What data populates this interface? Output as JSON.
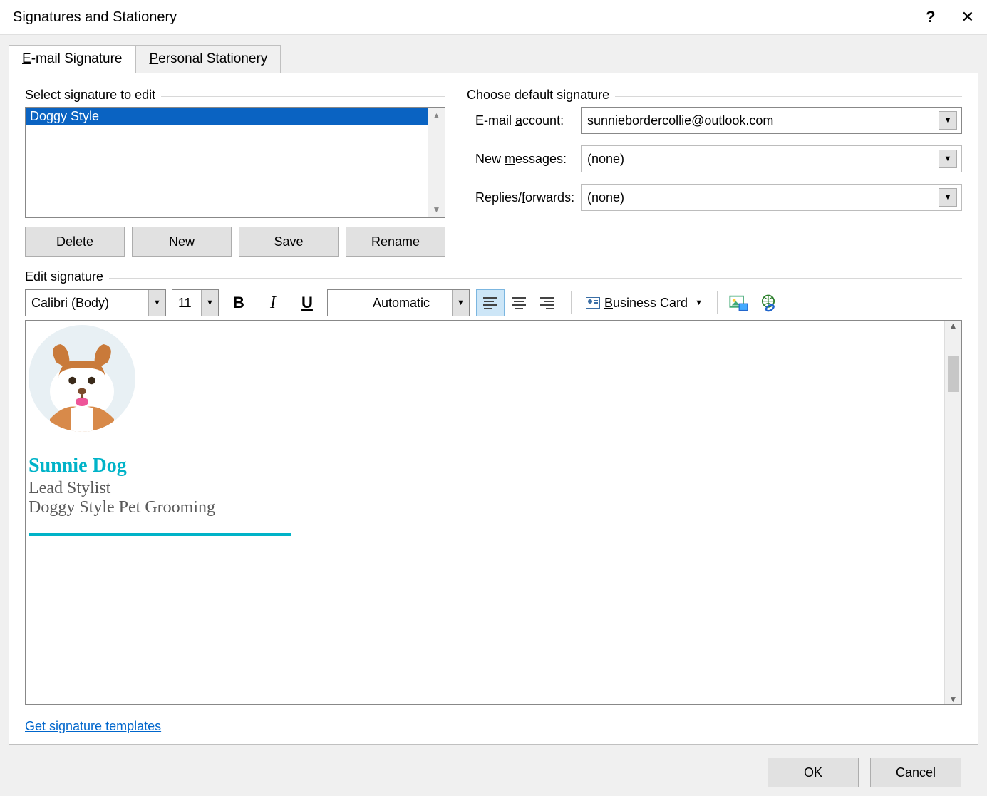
{
  "dialog": {
    "title": "Signatures and Stationery",
    "help": "?",
    "close": "✕"
  },
  "tabs": {
    "email_sig_prefix": "E",
    "email_sig_rest": "-mail Signature",
    "stationery_prefix": "P",
    "stationery_rest": "ersonal Stationery"
  },
  "left": {
    "group_label": "Select signature to edit",
    "signatures": [
      "Doggy Style"
    ],
    "buttons": {
      "delete_u": "D",
      "delete_r": "elete",
      "new_u": "N",
      "new_r": "ew",
      "save_u": "S",
      "save_r": "ave",
      "rename_u": "R",
      "rename_r": "ename"
    }
  },
  "right": {
    "group_label": "Choose default signature",
    "account_label_pre": "E-mail ",
    "account_label_u": "a",
    "account_label_post": "ccount:",
    "account_value": "sunniebordercollie@outlook.com",
    "newmsg_label_pre": "New ",
    "newmsg_label_u": "m",
    "newmsg_label_post": "essages:",
    "newmsg_value": "(none)",
    "replies_label_pre": "Replies/",
    "replies_label_u": "f",
    "replies_label_post": "orwards:",
    "replies_value": "(none)"
  },
  "editor": {
    "group_label": "Edit signature",
    "font": "Calibri (Body)",
    "size": "11",
    "bold": "B",
    "italic": "I",
    "underline": "U",
    "color": "Automatic",
    "bizcard_u": "B",
    "bizcard_r": "usiness Card"
  },
  "signature_preview": {
    "name": "Sunnie Dog",
    "title": "Lead Stylist",
    "company": "Doggy Style Pet Grooming"
  },
  "templates_link": "Get signature templates",
  "footer": {
    "ok": "OK",
    "cancel": "Cancel"
  }
}
